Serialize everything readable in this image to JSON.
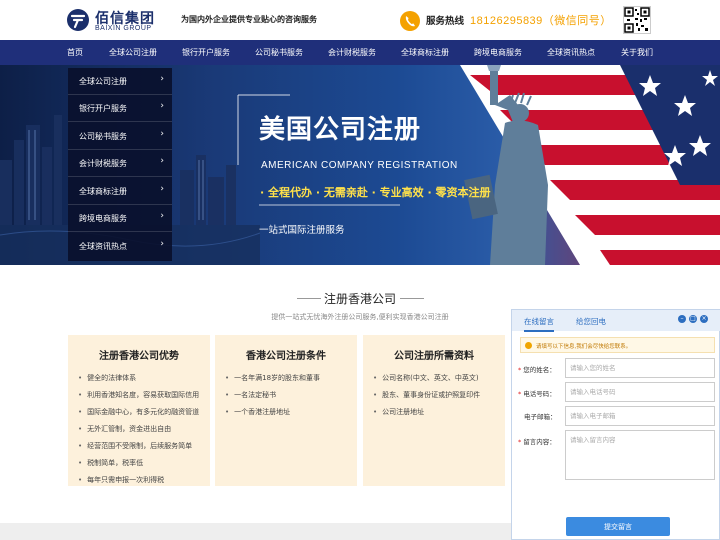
{
  "header": {
    "brand_name": "佰信集团",
    "brand_en": "BAIXIN GROUP",
    "slogan": "为国内外企业提供专业贴心的咨询服务",
    "hotline_label": "服务热线",
    "hotline_number": "18126295839（微信同号）",
    "brand_color": "#1b2f6b",
    "accent_color": "#f4a100"
  },
  "nav": {
    "items": [
      "首页",
      "全球公司注册",
      "银行开户服务",
      "公司秘书服务",
      "会计财税服务",
      "全球商标注册",
      "跨境电商服务",
      "全球资讯热点",
      "关于我们"
    ],
    "background": "#1f2f7a"
  },
  "side_menu": {
    "items": [
      "全球公司注册",
      "银行开户服务",
      "公司秘书服务",
      "会计财税服务",
      "全球商标注册",
      "跨境电商服务",
      "全球资讯热点"
    ],
    "chevron": "›"
  },
  "banner": {
    "title": "美国公司注册",
    "subtitle": "AMERICAN COMPANY REGISTRATION",
    "tagline": "· 全程代办 · 无需亲赴 · 专业高效 · 零资本注册",
    "note": "一站式国际注册服务"
  },
  "section": {
    "title": "注册香港公司",
    "subtitle": "提供一站式无忧海外注册公司服务,便利实现香港公司注册",
    "cards": [
      {
        "title": "注册香港公司优势",
        "items": [
          "健全的法律体系",
          "利用香港知名度，容易获取国际信用",
          "国际金融中心，有多元化的融资管道",
          "无外汇管制，资金进出自由",
          "经营范围不受限制，后续服务简单",
          "税制简单，税率低",
          "每年只需申报一次利得税"
        ]
      },
      {
        "title": "香港公司注册条件",
        "items": [
          "一名年满18岁的股东和董事",
          "一名法定秘书",
          "一个香港注册地址"
        ]
      },
      {
        "title": "公司注册所需资料",
        "items": [
          "公司名称(中文、英文、中英文)",
          "股东、董事身份证或护照复印件",
          "公司注册地址"
        ]
      }
    ]
  },
  "chat": {
    "tabs": [
      "在线留言",
      "给您回电"
    ],
    "notice": "请填写以下信息,我们会尽快给您联系。",
    "fields": [
      {
        "label": "您的姓名：",
        "placeholder": "请输入您的姓名",
        "required": true
      },
      {
        "label": "电话号码：",
        "placeholder": "请输入电话号码",
        "required": true
      },
      {
        "label": "电子邮箱：",
        "placeholder": "请输入电子邮箱",
        "required": false
      },
      {
        "label": "留言内容：",
        "placeholder": "请输入留言内容",
        "required": true
      }
    ],
    "submit_label": "提交留言",
    "controls": [
      "–",
      "□",
      "×"
    ],
    "accent_color": "#3b8be0"
  }
}
